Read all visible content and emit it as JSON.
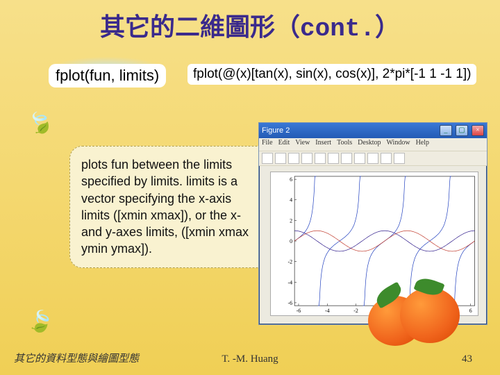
{
  "title_zh": "其它的二維圖形（",
  "title_mono": "cont.",
  "title_close": "）",
  "signature": "fplot(fun, limits)",
  "call_example": "fplot(@(x)[tan(x), sin(x), cos(x)], 2*pi*[-1 1 -1 1])",
  "description": "plots fun between the limits specified by limits. limits is a vector specifying the x-axis limits ([xmin xmax]), or the x- and y-axes limits, ([xmin xmax ymin ymax]).",
  "figure_window": {
    "title": "Figure 2",
    "menu": [
      "File",
      "Edit",
      "View",
      "Insert",
      "Tools",
      "Desktop",
      "Window",
      "Help"
    ]
  },
  "chart_data": {
    "type": "line",
    "xlim": [
      -6.2832,
      6.2832
    ],
    "ylim": [
      -6.2832,
      6.2832
    ],
    "xticks": [
      -6,
      -4,
      -2,
      0,
      2,
      4,
      6
    ],
    "yticks": [
      -6,
      -4,
      -2,
      0,
      2,
      4,
      6
    ],
    "series": [
      {
        "name": "tan(x)",
        "color": "#1f3fbf",
        "asymptotes": [
          -4.7124,
          -1.5708,
          1.5708,
          4.7124
        ]
      },
      {
        "name": "sin(x)",
        "color": "#c0392b"
      },
      {
        "name": "cos(x)",
        "color": "#2e1a8a"
      }
    ],
    "grid": false
  },
  "footer": {
    "left": "其它的資料型態與繪圖型態",
    "center": "T. -M. Huang",
    "right": "43"
  }
}
